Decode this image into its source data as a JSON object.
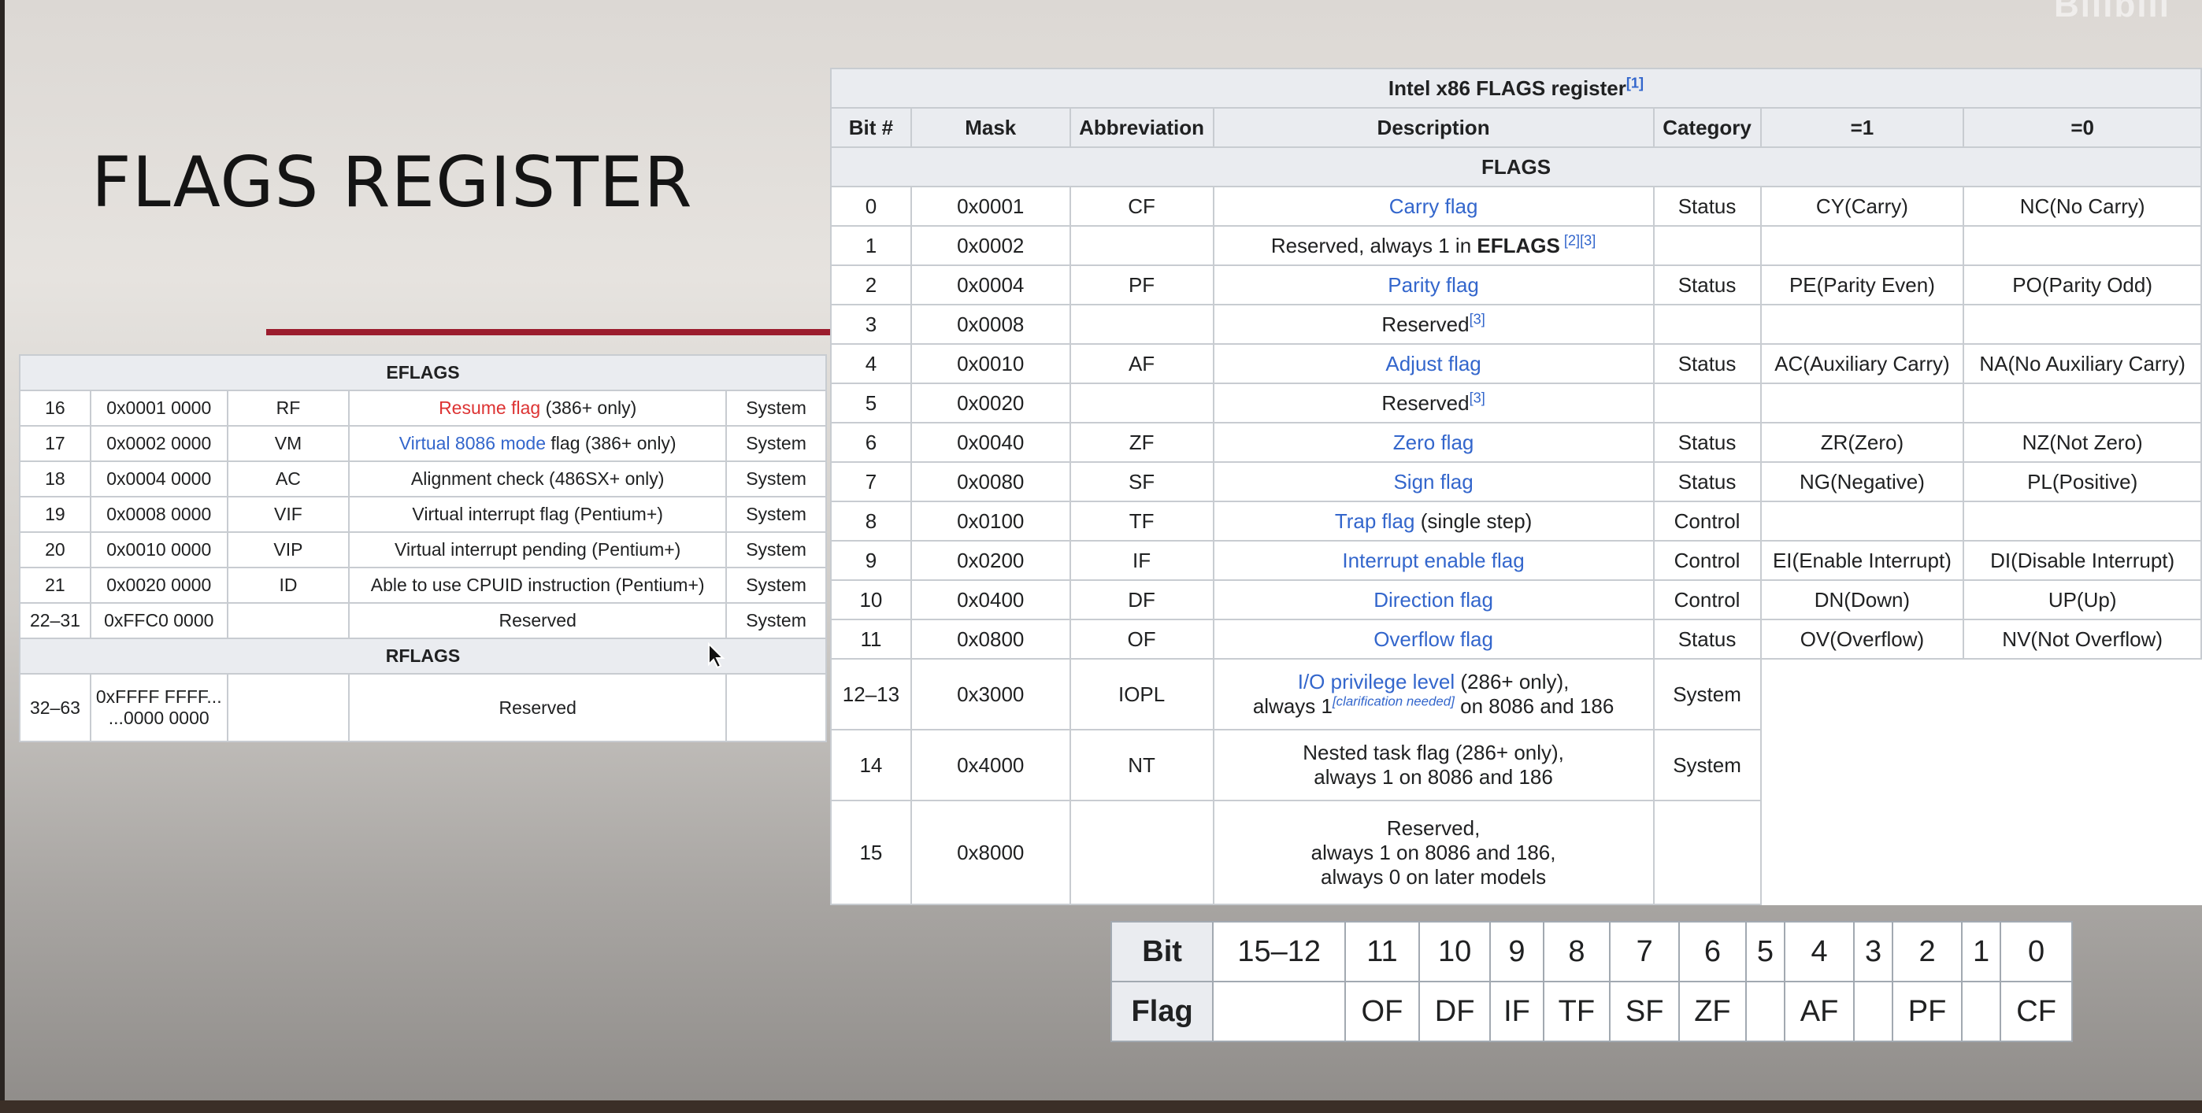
{
  "watermark": "Bilibili",
  "slide": {
    "title": "FLAGS REGISTER"
  },
  "eflags": {
    "section_eflags": "EFLAGS",
    "section_rflags": "RFLAGS",
    "rows": [
      {
        "bit": "16",
        "mask": "0x0001 0000",
        "abbr": "RF",
        "desc_link": "Resume flag",
        "desc_rest": " (386+ only)",
        "category": "System",
        "link_style": "red"
      },
      {
        "bit": "17",
        "mask": "0x0002 0000",
        "abbr": "VM",
        "desc_link": "Virtual 8086 mode",
        "desc_rest": " flag (386+ only)",
        "category": "System",
        "link_style": "blue"
      },
      {
        "bit": "18",
        "mask": "0x0004 0000",
        "abbr": "AC",
        "desc_link": "",
        "desc_rest": "Alignment check (486SX+ only)",
        "category": "System"
      },
      {
        "bit": "19",
        "mask": "0x0008 0000",
        "abbr": "VIF",
        "desc_link": "",
        "desc_rest": "Virtual interrupt flag (Pentium+)",
        "category": "System"
      },
      {
        "bit": "20",
        "mask": "0x0010 0000",
        "abbr": "VIP",
        "desc_link": "",
        "desc_rest": "Virtual interrupt pending (Pentium+)",
        "category": "System"
      },
      {
        "bit": "21",
        "mask": "0x0020 0000",
        "abbr": "ID",
        "desc_link": "",
        "desc_rest": "Able to use CPUID instruction (Pentium+)",
        "category": "System"
      },
      {
        "bit": "22–31",
        "mask": "0xFFC0 0000",
        "abbr": "",
        "desc_link": "",
        "desc_rest": "Reserved",
        "category": "System"
      }
    ],
    "rflags_row": {
      "bit": "32–63",
      "mask_line1": "0xFFFF FFFF...",
      "mask_line2": "...0000 0000",
      "abbr": "",
      "desc": "Reserved",
      "category": ""
    }
  },
  "main": {
    "caption": "Intel x86 FLAGS register",
    "caption_ref": "[1]",
    "headers": [
      "Bit #",
      "Mask",
      "Abbreviation",
      "Description",
      "Category",
      "=1",
      "=0"
    ],
    "section": "FLAGS",
    "rows": [
      {
        "bit": "0",
        "mask": "0x0001",
        "abbr": "CF",
        "desc_link": "Carry flag",
        "category": "Status",
        "one": "CY(Carry)",
        "zero": "NC(No Carry)"
      },
      {
        "bit": "1",
        "mask": "0x0002",
        "abbr": "",
        "desc_pre": "Reserved, always 1 in ",
        "desc_bold": "EFLAGS",
        "desc_ref": " [2][3]"
      },
      {
        "bit": "2",
        "mask": "0x0004",
        "abbr": "PF",
        "desc_link": "Parity flag",
        "category": "Status",
        "one": "PE(Parity Even)",
        "zero": "PO(Parity Odd)"
      },
      {
        "bit": "3",
        "mask": "0x0008",
        "abbr": "",
        "desc_pre": "Reserved",
        "desc_ref": "[3]"
      },
      {
        "bit": "4",
        "mask": "0x0010",
        "abbr": "AF",
        "desc_link": "Adjust flag",
        "category": "Status",
        "one": "AC(Auxiliary Carry)",
        "zero": "NA(No Auxiliary Carry)"
      },
      {
        "bit": "5",
        "mask": "0x0020",
        "abbr": "",
        "desc_pre": "Reserved",
        "desc_ref": "[3]"
      },
      {
        "bit": "6",
        "mask": "0x0040",
        "abbr": "ZF",
        "desc_link": "Zero flag",
        "category": "Status",
        "one": "ZR(Zero)",
        "zero": "NZ(Not Zero)"
      },
      {
        "bit": "7",
        "mask": "0x0080",
        "abbr": "SF",
        "desc_link": "Sign flag",
        "category": "Status",
        "one": "NG(Negative)",
        "zero": "PL(Positive)"
      },
      {
        "bit": "8",
        "mask": "0x0100",
        "abbr": "TF",
        "desc_link": "Trap flag",
        "desc_rest": " (single step)",
        "category": "Control"
      },
      {
        "bit": "9",
        "mask": "0x0200",
        "abbr": "IF",
        "desc_link": "Interrupt enable flag",
        "category": "Control",
        "one": "EI(Enable Interrupt)",
        "zero": "DI(Disable Interrupt)"
      },
      {
        "bit": "10",
        "mask": "0x0400",
        "abbr": "DF",
        "desc_link": "Direction flag",
        "category": "Control",
        "one": "DN(Down)",
        "zero": "UP(Up)"
      },
      {
        "bit": "11",
        "mask": "0x0800",
        "abbr": "OF",
        "desc_link": "Overflow flag",
        "category": "Status",
        "one": "OV(Overflow)",
        "zero": "NV(Not Overflow)"
      }
    ],
    "row_12_13": {
      "bit": "12–13",
      "mask": "0x3000",
      "abbr": "IOPL",
      "desc_link": "I/O privilege level",
      "desc_rest": " (286+ only),",
      "desc_line2_pre": "always 1",
      "desc_cite": "[clarification needed]",
      "desc_line2_post": " on 8086 and 186",
      "category": "System"
    },
    "row_14": {
      "bit": "14",
      "mask": "0x4000",
      "abbr": "NT",
      "desc_line1": "Nested task flag (286+ only),",
      "desc_line2": "always 1 on 8086 and 186",
      "category": "System"
    },
    "row_15": {
      "bit": "15",
      "mask": "0x8000",
      "abbr": "",
      "desc_line1": "Reserved,",
      "desc_line2": "always 1 on 8086 and 186,",
      "desc_line3": "always 0 on later models",
      "category": ""
    }
  },
  "bit_table": {
    "bit_label": "Bit",
    "flag_label": "Flag",
    "bits": [
      "15–12",
      "11",
      "10",
      "9",
      "8",
      "7",
      "6",
      "5",
      "4",
      "3",
      "2",
      "1",
      "0"
    ],
    "flags": [
      "",
      "OF",
      "DF",
      "IF",
      "TF",
      "SF",
      "ZF",
      "",
      "AF",
      "",
      "PF",
      "",
      "CF"
    ]
  }
}
